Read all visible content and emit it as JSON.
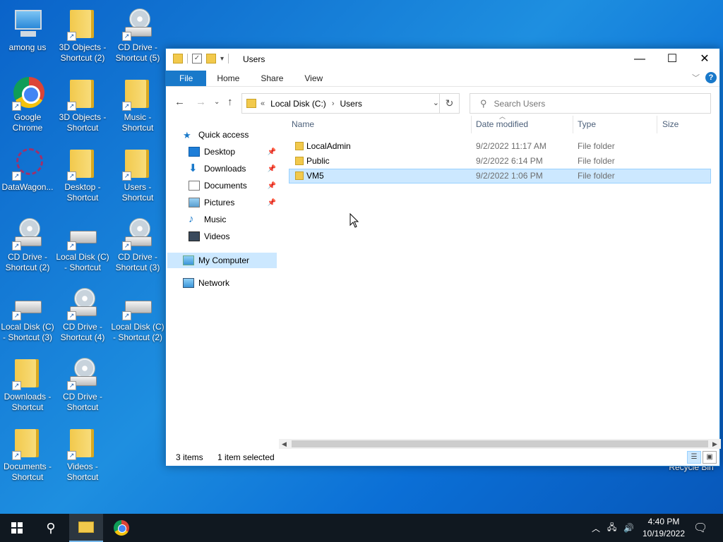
{
  "desktop": {
    "icons": [
      {
        "label": "among us",
        "kind": "monitor"
      },
      {
        "label": "3D Objects -\nShortcut (2)",
        "kind": "folder"
      },
      {
        "label": "CD Drive -\nShortcut (5)",
        "kind": "cd"
      },
      {
        "label": "Google\nChrome",
        "kind": "chrome"
      },
      {
        "label": "3D Objects -\nShortcut",
        "kind": "folder"
      },
      {
        "label": "Music -\nShortcut",
        "kind": "folder"
      },
      {
        "label": "DataWagon...",
        "kind": "wagon"
      },
      {
        "label": "Desktop -\nShortcut",
        "kind": "folder"
      },
      {
        "label": "Users -\nShortcut",
        "kind": "folder"
      },
      {
        "label": "CD Drive -\nShortcut (2)",
        "kind": "cd"
      },
      {
        "label": "Local Disk (C)\n- Shortcut",
        "kind": "disk"
      },
      {
        "label": "CD Drive -\nShortcut (3)",
        "kind": "cd"
      },
      {
        "label": "Local Disk (C)\n- Shortcut (3)",
        "kind": "disk"
      },
      {
        "label": "CD Drive -\nShortcut (4)",
        "kind": "cd"
      },
      {
        "label": "Local Disk (C)\n- Shortcut (2)",
        "kind": "disk"
      },
      {
        "label": "Downloads -\nShortcut",
        "kind": "folder"
      },
      {
        "label": "CD Drive -\nShortcut",
        "kind": "cd"
      },
      {
        "label": "Documents -\nShortcut",
        "kind": "folder"
      },
      {
        "label": "Videos -\nShortcut",
        "kind": "folder"
      }
    ],
    "recycle_bin_label": "Recycle Bin"
  },
  "window": {
    "title": "Users",
    "controls": {
      "minimize": "—",
      "maximize": "☐",
      "close": "✕"
    },
    "ribbon_tabs": [
      "File",
      "Home",
      "Share",
      "View"
    ],
    "address": {
      "root": "Local Disk (C:)",
      "current": "Users",
      "overflow": "«"
    },
    "search": {
      "placeholder": "Search Users"
    },
    "sidebar": {
      "quick_access": "Quick access",
      "quick_items": [
        "Desktop",
        "Downloads",
        "Documents",
        "Pictures",
        "Music",
        "Videos"
      ],
      "this_pc": "My Computer",
      "network": "Network"
    },
    "columns": [
      "Name",
      "Date modified",
      "Type",
      "Size"
    ],
    "rows": [
      {
        "name": "LocalAdmin",
        "date": "9/2/2022 11:17 AM",
        "type": "File folder"
      },
      {
        "name": "Public",
        "date": "9/2/2022 6:14 PM",
        "type": "File folder"
      },
      {
        "name": "VM5",
        "date": "9/2/2022 1:06 PM",
        "type": "File folder"
      }
    ],
    "status": {
      "items": "3 items",
      "selected": "1 item selected"
    }
  },
  "taskbar": {
    "time": "4:40 PM",
    "date": "10/19/2022"
  }
}
